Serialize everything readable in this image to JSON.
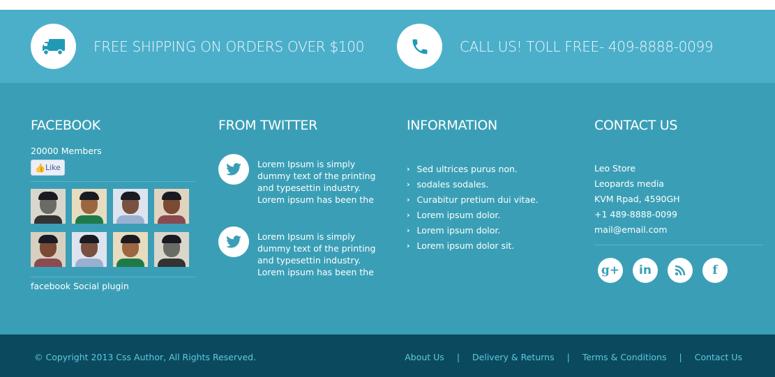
{
  "banner": {
    "shipping": "FREE SHIPPING ON ORDERS OVER $100",
    "call": "CALL US! TOLL FREE- 409-8888-0099"
  },
  "facebook": {
    "title": "FACEBOOK",
    "members": "20000 Members",
    "like": "Like",
    "plugin": "facebook Social plugin",
    "avatars": [
      {
        "bg": "#d9d6cc",
        "skin": "#6b6b66",
        "shirt": "#333"
      },
      {
        "bg": "#e8dcc0",
        "skin": "#9b6640",
        "shirt": "#1f7a4a"
      },
      {
        "bg": "#dde4ef",
        "skin": "#7a5040",
        "shirt": "#9ab0d0"
      },
      {
        "bg": "#e0d4c0",
        "skin": "#7a4a32",
        "shirt": "#8a4a50"
      },
      {
        "bg": "#d8cfc0",
        "skin": "#7a4a32",
        "shirt": "#8a4a50"
      },
      {
        "bg": "#dde4ef",
        "skin": "#7a5040",
        "shirt": "#9ab0d0"
      },
      {
        "bg": "#e8dcc0",
        "skin": "#9b6640",
        "shirt": "#1f7a4a"
      },
      {
        "bg": "#d9d6cc",
        "skin": "#6b6b66",
        "shirt": "#333"
      }
    ]
  },
  "twitter": {
    "title": "FROM TWITTER",
    "tweets": [
      {
        "lines": [
          "Lorem Ipsum is simply",
          "dummy text of the printing",
          "and typesettin industry.",
          "Lorem ipsum has been the"
        ]
      },
      {
        "lines": [
          "Lorem Ipsum is simply",
          "dummy text of the printing",
          "and typesettin industry.",
          "Lorem ipsum has been the"
        ]
      }
    ]
  },
  "information": {
    "title": "INFORMATION",
    "items": [
      "Sed ultrices purus non.",
      "sodales sodales.",
      "Curabitur pretium dui vitae.",
      "Lorem ipsum dolor.",
      "Lorem ipsum dolor.",
      "Lorem ipsum dolor sit."
    ]
  },
  "contact": {
    "title": "CONTACT US",
    "lines": [
      "Leo Store",
      "Leopards media",
      "KVM Rpad, 4590GH",
      "+1 489-8888-0099",
      "mail@email.com"
    ],
    "social": [
      {
        "icon": "google-plus-icon",
        "glyph": "g+"
      },
      {
        "icon": "linkedin-icon",
        "glyph": "in"
      },
      {
        "icon": "rss-icon",
        "glyph": "rss"
      },
      {
        "icon": "facebook-icon",
        "glyph": "f"
      }
    ]
  },
  "footer": {
    "copyright": "© Copyright 2013 Css Author, All Rights Reserved.",
    "links": [
      "About Us",
      "Delivery & Returns",
      "Terms & Conditions",
      "Contact Us"
    ],
    "separator": "|"
  }
}
